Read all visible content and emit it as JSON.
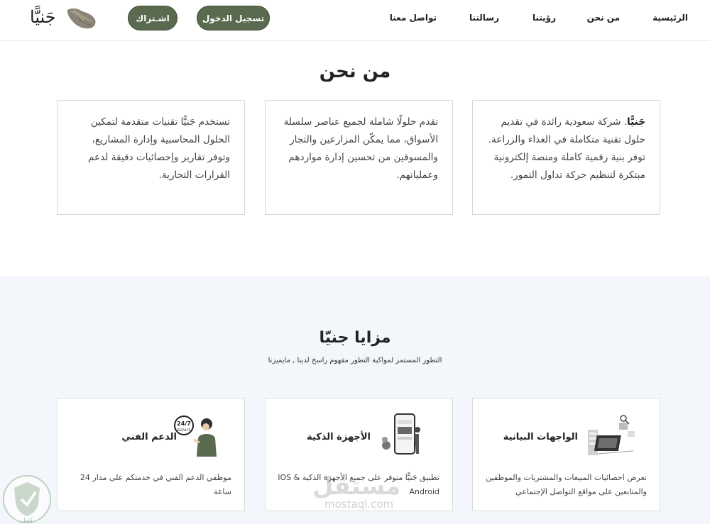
{
  "nav": {
    "home": "الرئيسية",
    "about": "من نحن",
    "vision": "رؤيتنا",
    "message": "رسالتنا",
    "contact": "تواصل معنا"
  },
  "buttons": {
    "login": "تسجيل الدخول",
    "subscribe": "اشـتراك"
  },
  "brand": {
    "logo_text": "جَنيًّا"
  },
  "about": {
    "title": "من نحن",
    "cards": [
      {
        "brand": "جَنيًّا",
        "text": ". شركة سعودية رائدة في تقديم حلول تقنية متكاملة في الغذاء والزراعة. توفر بنية رقمية كاملة ومنصة إلكترونية مبتكرة لتنظيم حركة تداول التمور."
      },
      {
        "text": "تقدم حلولًا شاملة لجميع عناصر سلسلة الأسواق، مما يمكّن المزارعين والتجار والمسوقين من تحسين إدارة مواردهم وعملياتهم."
      },
      {
        "text": "تستخدم جَنيًّا تقنيات متقدمة لتمكين الحلول المحاسبية وإدارة المشاريع، وتوفر تقارير وإحصائيات دقيقة لدعم القرارات التجارية."
      }
    ]
  },
  "features": {
    "title": "مزايا جنيّا",
    "subtitle": "التطور المستمر لمواكبة التطور مفهوم راسخ لدينا , مايميزنا",
    "cards": [
      {
        "title": "الواجهات البيانية",
        "desc": "تعرض احصائيات المبيعات والمشتريات والموظفين والمتابعين على مواقع التواصل الإجتماعي",
        "icon": "dashboard-illustration-icon"
      },
      {
        "title": "الأجهزة الذكية",
        "desc": "تطبيق جَنيًّا متوفر على جميع الأجهزة الذكية IOS & Android",
        "icon": "smartphone-illustration-icon"
      },
      {
        "title": "الدعم الفني",
        "desc": "موظفي الدعم الفني في خدمتكم على مدار 24 ساعة",
        "icon": "support-agent-illustration-icon",
        "badge_top": "24/7",
        "badge_bottom": "SERVICE"
      }
    ]
  },
  "watermark": {
    "text": "مستقل",
    "url": "mostaql.com",
    "badge": "كفيل"
  },
  "colors": {
    "button_bg": "#5a6a4e",
    "features_bg": "#f3f6fa"
  }
}
